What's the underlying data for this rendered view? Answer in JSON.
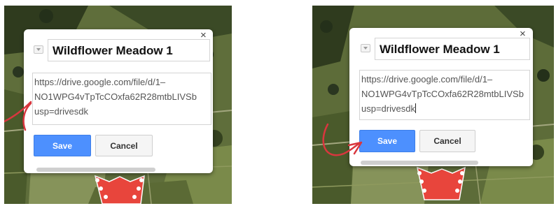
{
  "screens": [
    {
      "title": "Wildflower Meadow 1",
      "url_lines": [
        "https://drive.google.com/file/d/1–",
        "NO1WPG4vTpTcCOxfa62R28mtbLIVSb",
        "usp=drivesdk"
      ],
      "save_label": "Save",
      "cancel_label": "Cancel",
      "close_glyph": "×"
    },
    {
      "title": "Wildflower Meadow 1",
      "url_lines": [
        "https://drive.google.com/file/d/1–",
        "NO1WPG4vTpTcCOxfa62R28mtbLIVSb",
        "usp=drivesdk"
      ],
      "save_label": "Save",
      "cancel_label": "Cancel",
      "close_glyph": "×"
    }
  ],
  "icons": {
    "close": "close-icon",
    "collapse": "collapse-arrow-icon",
    "polygon": "red-polygon-shape"
  },
  "colors": {
    "save_button": "#4d90fe",
    "polygon": "#e8453c",
    "annotation": "#d9363e"
  }
}
